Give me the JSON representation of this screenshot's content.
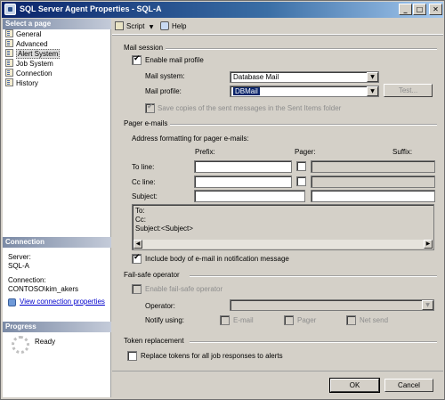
{
  "window": {
    "title": "SQL Server Agent Properties - SQL-A",
    "minimize": "_",
    "maximize": "□",
    "close": "✕"
  },
  "left": {
    "select_page_header": "Select a page",
    "pages": [
      "General",
      "Advanced",
      "Alert System",
      "Job System",
      "Connection",
      "History"
    ],
    "selected_page": "Alert System",
    "connection_header": "Connection",
    "server_label": "Server:",
    "server_value": "SQL-A",
    "connection_label": "Connection:",
    "connection_value": "CONTOSO\\kim_akers",
    "view_connection_properties": "View connection properties",
    "progress_header": "Progress",
    "progress_status": "Ready"
  },
  "toolbar": {
    "script_label": "Script",
    "help_label": "Help"
  },
  "mail_session": {
    "section_title": "Mail session",
    "enable_mail_profile_label": "Enable mail profile",
    "enable_mail_profile_checked": true,
    "mail_system_label": "Mail system:",
    "mail_system_value": "Database Mail",
    "mail_profile_label": "Mail profile:",
    "mail_profile_value": "DBMail",
    "test_button": "Test...",
    "save_copies_label": "Save copies of the sent messages in the Sent Items folder",
    "save_copies_checked": true
  },
  "pager": {
    "section_title": "Pager e-mails",
    "address_formatting_label": "Address formatting for pager e-mails:",
    "prefix_header": "Prefix:",
    "pager_header": "Pager:",
    "suffix_header": "Suffix:",
    "to_line_label": "To line:",
    "cc_line_label": "Cc line:",
    "subject_label": "Subject:",
    "preview_lines": [
      "To:",
      "Cc:",
      "Subject:<Subject>"
    ],
    "include_body_label": "Include body of e-mail in notification message",
    "include_body_checked": true
  },
  "failsafe": {
    "section_title": "Fail-safe operator",
    "enable_failsafe_label": "Enable fail-safe operator",
    "operator_label": "Operator:",
    "operator_value": "",
    "notify_using_label": "Notify using:",
    "email_label": "E-mail",
    "pager_label": "Pager",
    "net_send_label": "Net send"
  },
  "token": {
    "section_title": "Token replacement",
    "replace_tokens_label": "Replace tokens for all job responses to alerts",
    "replace_tokens_checked": false
  },
  "buttons": {
    "ok": "OK",
    "cancel": "Cancel"
  }
}
